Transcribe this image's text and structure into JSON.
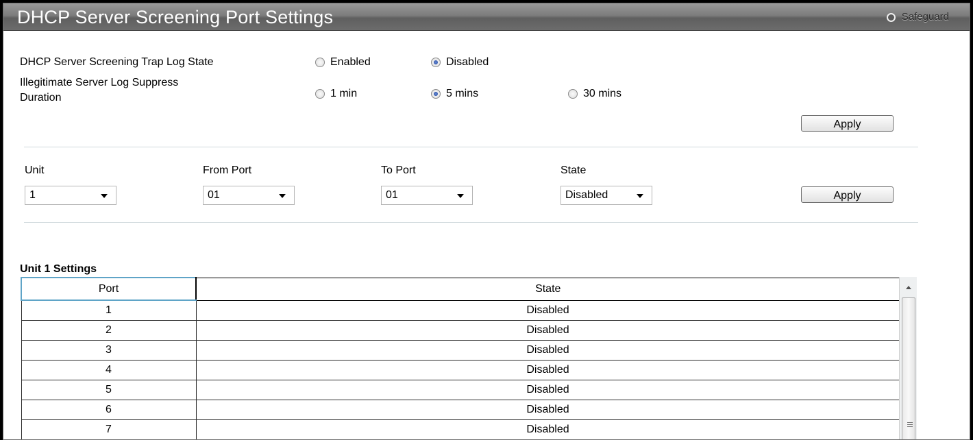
{
  "header": {
    "title": "DHCP Server Screening Port Settings",
    "safeguard_label": "Safeguard"
  },
  "trap_log": {
    "label": "DHCP Server Screening Trap Log State",
    "options": [
      "Enabled",
      "Disabled"
    ],
    "selected": "Disabled"
  },
  "suppress": {
    "label_line1": "Illegitimate Server Log Suppress",
    "label_line2": "Duration",
    "options": [
      "1 min",
      "5 mins",
      "30 mins"
    ],
    "selected": "5 mins"
  },
  "apply_label": "Apply",
  "port_form": {
    "unit_label": "Unit",
    "unit_value": "1",
    "from_label": "From Port",
    "from_value": "01",
    "to_label": "To Port",
    "to_value": "01",
    "state_label": "State",
    "state_value": "Disabled",
    "apply_label": "Apply"
  },
  "table": {
    "section_title": "Unit 1 Settings",
    "columns": [
      "Port",
      "State"
    ],
    "rows": [
      [
        "1",
        "Disabled"
      ],
      [
        "2",
        "Disabled"
      ],
      [
        "3",
        "Disabled"
      ],
      [
        "4",
        "Disabled"
      ],
      [
        "5",
        "Disabled"
      ],
      [
        "6",
        "Disabled"
      ],
      [
        "7",
        "Disabled"
      ]
    ]
  }
}
